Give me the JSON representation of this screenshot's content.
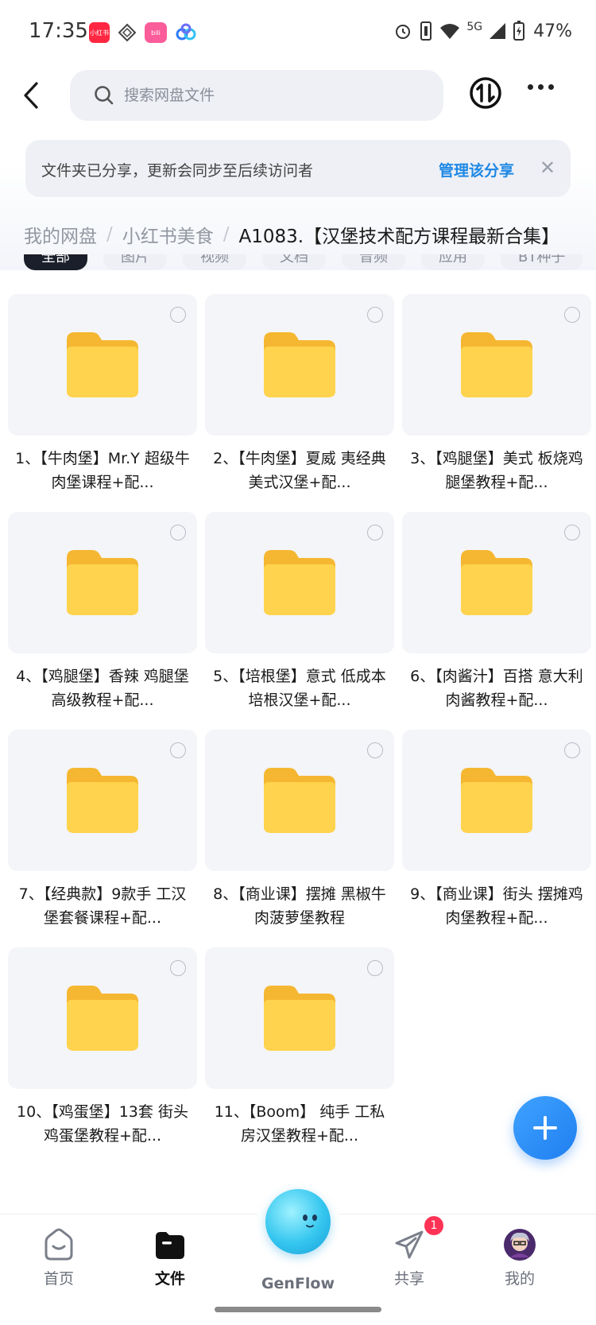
{
  "status_bar": {
    "time": "17:35",
    "battery": "47%",
    "network": "5G",
    "app_icons": [
      "xiaohongshu-icon",
      "diamond-app-icon",
      "bilibili-icon",
      "cloud-app-icon"
    ]
  },
  "header": {
    "search_placeholder": "搜索网盘文件"
  },
  "share_banner": {
    "text": "文件夹已分享，更新会同步至后续访问者",
    "action": "管理该分享",
    "close": "✕"
  },
  "breadcrumb": {
    "items": [
      "我的网盘",
      "小红书美食"
    ],
    "current": "A1083.【汉堡技术配方课程最新合集】"
  },
  "filters": [
    "全部",
    "图片",
    "视频",
    "文档",
    "音频",
    "应用",
    "BT种子"
  ],
  "folders": [
    "1、【牛肉堡】Mr.Y 超级牛肉堡课程+配...",
    "2、【牛肉堡】夏威 夷经典美式汉堡+配...",
    "3、【鸡腿堡】美式 板烧鸡腿堡教程+配...",
    "4、【鸡腿堡】香辣 鸡腿堡高级教程+配...",
    "5、【培根堡】意式 低成本培根汉堡+配...",
    "6、【肉酱汁】百搭 意大利肉酱教程+配...",
    "7、【经典款】9款手 工汉堡套餐课程+配...",
    "8、【商业课】摆摊 黑椒牛肉菠萝堡教程",
    "9、【商业课】街头 摆摊鸡肉堡教程+配...",
    "10、【鸡蛋堡】13套 街头鸡蛋堡教程+配...",
    "11、【Boom】 纯手 工私房汉堡教程+配..."
  ],
  "bottom_nav": {
    "home": "首页",
    "files": "文件",
    "genflow": "GenFlow",
    "share": "共享",
    "share_badge": "1",
    "mine": "我的"
  },
  "colors": {
    "accent": "#1e88e5",
    "folder": "#ffc83d",
    "badge": "#ff3355"
  }
}
